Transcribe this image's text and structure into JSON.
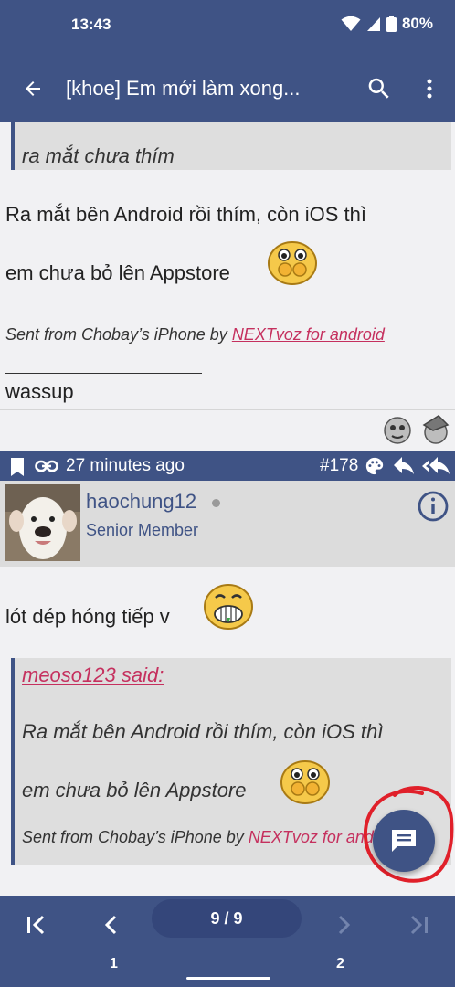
{
  "status": {
    "time": "13:43",
    "battery": "80%"
  },
  "appbar": {
    "title": "[khoe] Em mới làm xong..."
  },
  "prev_post": {
    "quote_tail": "ra mắt chưa thím",
    "line1": "Ra mắt bên Android rồi thím, còn iOS thì",
    "line2": "em chưa bỏ lên Appstore",
    "signature_prefix": "Sent from Chobay’s iPhone by ",
    "signature_link": "NEXTvoz for android",
    "signature_after_line": "wassup"
  },
  "post": {
    "time": "27 minutes ago",
    "number": "#178",
    "username": "haochung12",
    "rank": "Senior Member",
    "body": "lót dép hóng tiếp v",
    "quote": {
      "author": "meoso123 said:",
      "line1": "Ra mắt bên Android rồi thím, còn iOS thì",
      "line2": "em chưa bỏ lên Appstore",
      "signature_prefix": "Sent from Chobay’s iPhone by ",
      "signature_link": "NEXTvoz for android"
    }
  },
  "pagination": {
    "indicator": "9 / 9",
    "page_left": "1",
    "page_right": "2"
  },
  "colors": {
    "primary": "#3f5385",
    "link": "#c5305e",
    "annotation": "#e0202a"
  }
}
